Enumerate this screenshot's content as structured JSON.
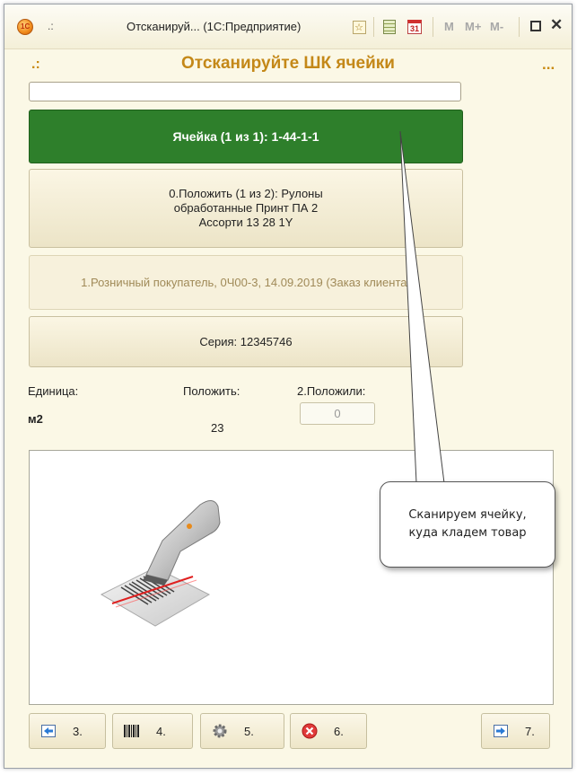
{
  "titlebar": {
    "dots": ".:",
    "title": "Отсканируй... (1С:Предприятие)",
    "logo_text": "1C",
    "calendar_day": "31",
    "m_label": "M",
    "m_plus_label": "M+",
    "m_minus_label": "M-",
    "close_glyph": "✕"
  },
  "header": {
    "dots": ".:",
    "title": "Отсканируйте ШК ячейки",
    "more": "..."
  },
  "scan_input": {
    "value": ""
  },
  "cell_button": {
    "label": "Ячейка (1 из 1): 1-44-1-1"
  },
  "put_button": {
    "line1": "0.Положить (1 из 2): Рулоны",
    "line2": "обработанные Принт ПА 2",
    "line3": "Ассорти 13 28  1Y"
  },
  "order_button": {
    "label": "1.Розничный покупатель, 0Ч00-3, 14.09.2019 (Заказ клиента)"
  },
  "series_button": {
    "label": "Серия: 12345746"
  },
  "fields": {
    "unit_label": "Единица:",
    "unit_value": "м2",
    "put_label": "Положить:",
    "put_value": "23",
    "placed_label": "2.Положили:",
    "placed_value": "0"
  },
  "toolbar": {
    "b3": "3.",
    "b4": "4.",
    "b5": "5.",
    "b6": "6.",
    "b7": "7."
  },
  "callout": {
    "line1": "Сканируем ячейку,",
    "line2": "куда кладем товар"
  },
  "colors": {
    "accent": "#c48818",
    "green_button": "#2e7f2b",
    "background": "#fbf8e6"
  }
}
